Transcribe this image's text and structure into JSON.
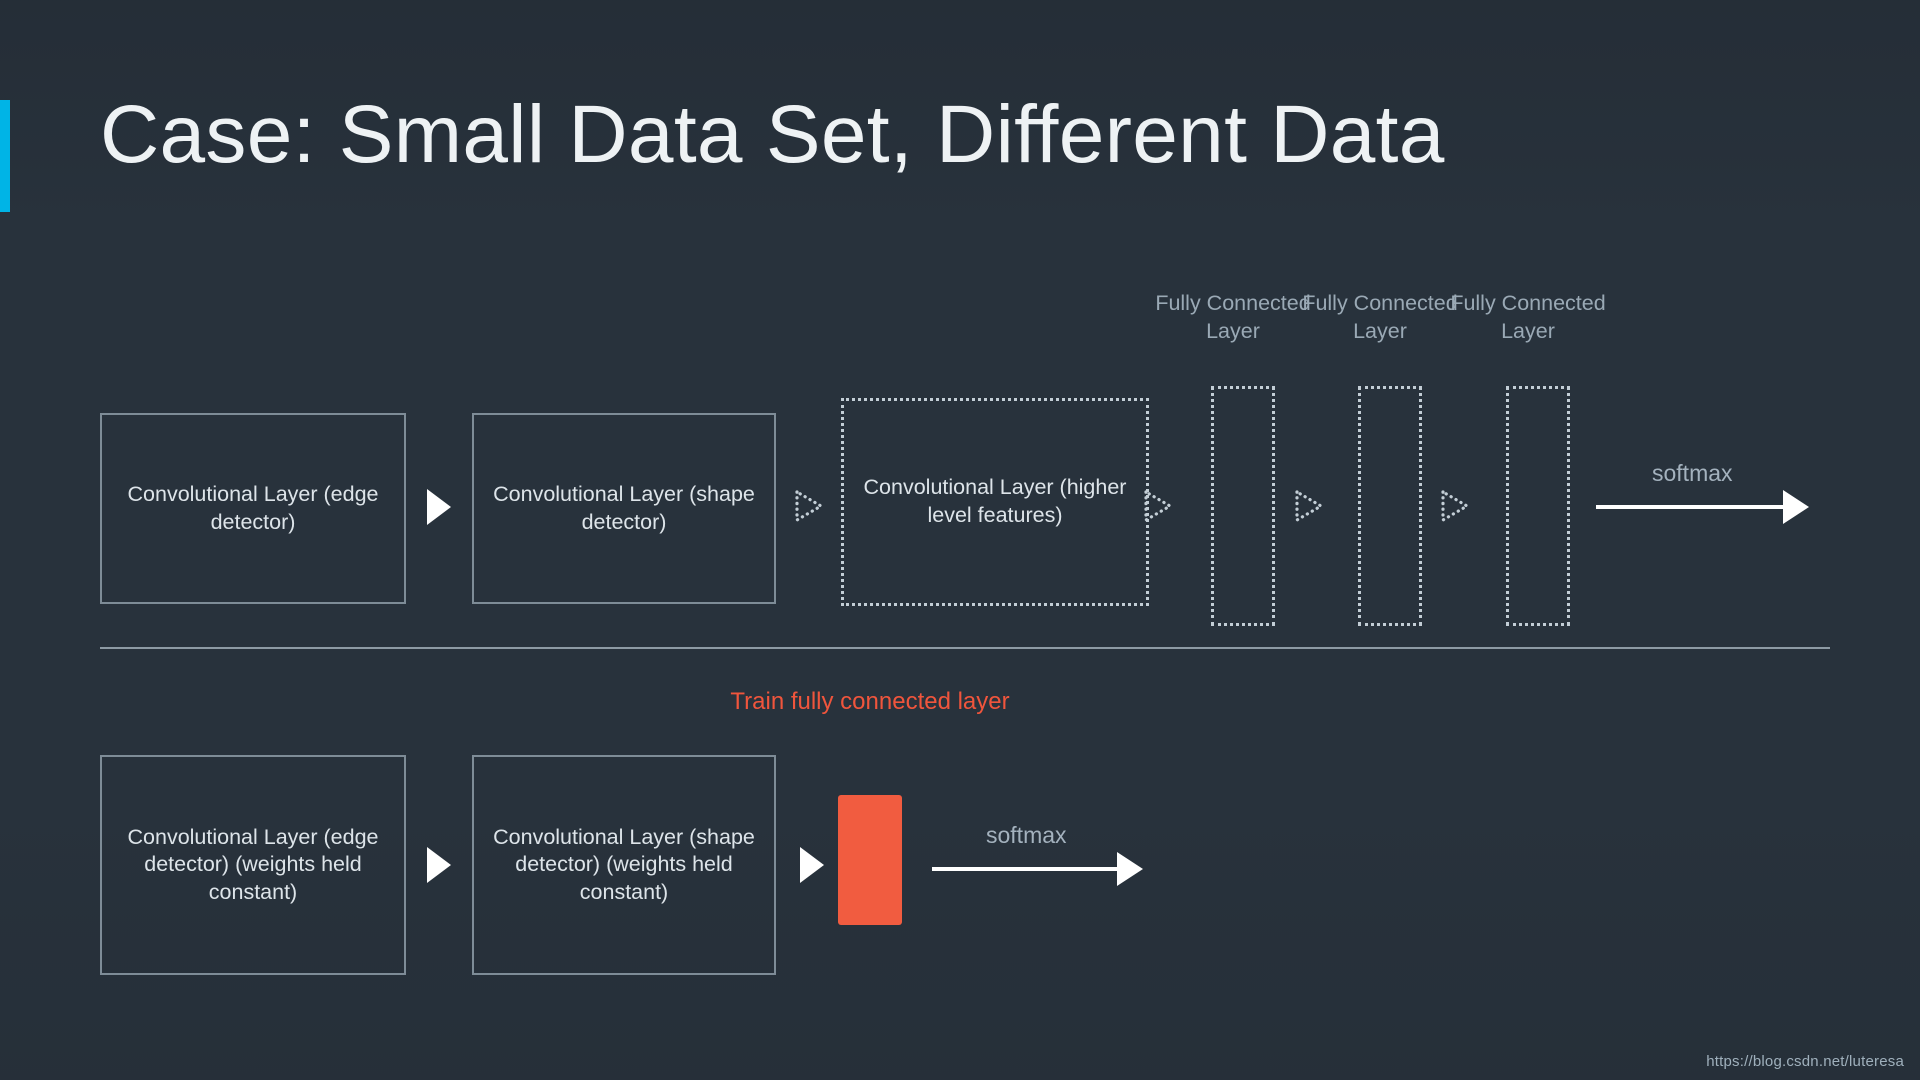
{
  "slide": {
    "title": "Case: Small Data Set, Different Data",
    "accent_color": "#00b4e6",
    "background_color": "#28323c",
    "watermark": "https://blog.csdn.net/luteresa"
  },
  "top_row": {
    "boxes": [
      {
        "text": "Convolutional Layer (edge detector)",
        "style": "solid"
      },
      {
        "text": "Convolutional Layer (shape detector)",
        "style": "solid"
      },
      {
        "text": "Convolutional Layer (higher level features)",
        "style": "dotted"
      }
    ],
    "fc_layers": [
      {
        "label": "Fully Connected Layer"
      },
      {
        "label": "Fully Connected Layer"
      },
      {
        "label": "Fully Connected Layer"
      }
    ],
    "softmax_label": "softmax"
  },
  "divider": {
    "caption": "Train fully connected layer",
    "caption_color": "#f0553c"
  },
  "bottom_row": {
    "boxes": [
      {
        "text": "Convolutional Layer (edge detector) (weights held constant)",
        "style": "solid"
      },
      {
        "text": "Convolutional Layer (shape detector) (weights held constant)",
        "style": "solid"
      }
    ],
    "trained_block_color": "#f15c40",
    "softmax_label": "softmax"
  },
  "icons": {
    "arrow_solid": "play-triangle-icon",
    "arrow_dotted": "play-triangle-dotted-icon",
    "arrow_line": "right-arrow-icon"
  }
}
